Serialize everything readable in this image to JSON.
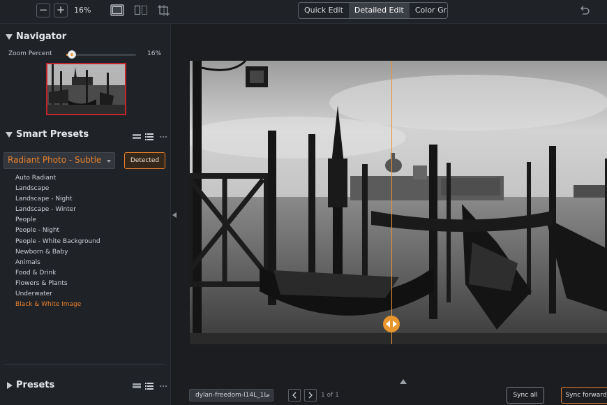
{
  "toolbar": {
    "zoom_out_label": "−",
    "zoom_in_label": "+",
    "zoom_value": "16%",
    "modes": [
      "Quick Edit",
      "Detailed Edit",
      "Color Grade"
    ],
    "active_mode": "Detailed Edit",
    "icons": [
      "single-view-icon",
      "split-view-icon",
      "crop-icon",
      "undo-icon"
    ]
  },
  "navigator": {
    "title": "Navigator",
    "zoom_label": "Zoom Percent",
    "zoom_value": "16%",
    "zoom_fraction": 0.16
  },
  "smart_presets": {
    "title": "Smart Presets",
    "selected": "Radiant Photo - Subtle",
    "detected_label": "Detected",
    "items": [
      "Auto Radiant",
      "Landscape",
      "Landscape - Night",
      "Landscape - Winter",
      "People",
      "People - Night",
      "People - White Background",
      "Newborn & Baby",
      "Animals",
      "Food & Drink",
      "Flowers & Plants",
      "Underwater",
      "Black & White Image"
    ],
    "active_item": "Black & White Image"
  },
  "presets": {
    "title": "Presets"
  },
  "bottom": {
    "file_name": "dylan-freedom-I14L_1L",
    "counter": "1 of 1",
    "sync_all": "Sync all",
    "sync_forward": "Sync forward"
  },
  "colors": {
    "accent": "#e8812d",
    "split_line": "#e8962e",
    "navigator_border": "#c0262b"
  }
}
